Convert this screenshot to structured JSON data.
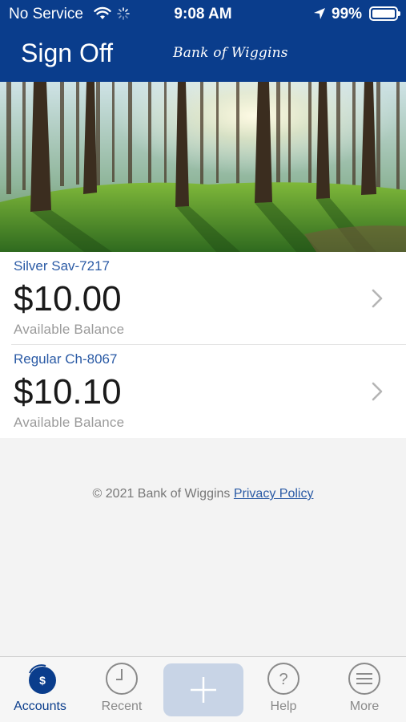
{
  "status_bar": {
    "carrier": "No Service",
    "time": "9:08 AM",
    "battery": "99%"
  },
  "header": {
    "sign_off": "Sign Off",
    "brand": "Bank of Wiggins"
  },
  "accounts": [
    {
      "name": "Silver Sav-7217",
      "balance": "$10.00",
      "balance_label": "Available Balance"
    },
    {
      "name": "Regular Ch-8067",
      "balance": "$10.10",
      "balance_label": "Available Balance"
    }
  ],
  "footer": {
    "copyright": "© 2021 Bank of Wiggins",
    "privacy": "Privacy Policy"
  },
  "tabs": [
    {
      "label": "Accounts",
      "icon": "dollar-icon",
      "active": true
    },
    {
      "label": "Recent",
      "icon": "clock-icon"
    },
    {
      "label": "",
      "icon": "plus-icon"
    },
    {
      "label": "Help",
      "icon": "question-icon"
    },
    {
      "label": "More",
      "icon": "menu-icon"
    }
  ],
  "colors": {
    "header": "#0a3d8c",
    "link": "#2a5aa5",
    "tab_active": "#0a3d8c"
  }
}
